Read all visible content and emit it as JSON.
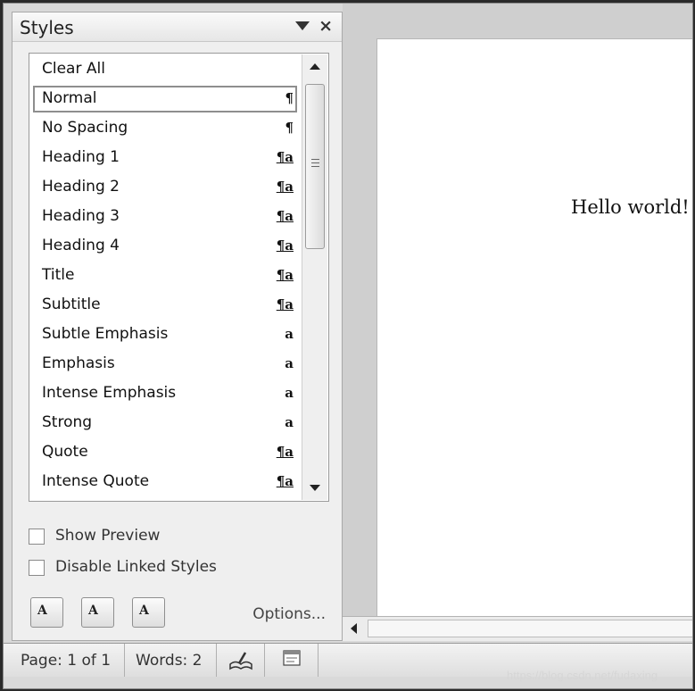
{
  "pane": {
    "title": "Styles",
    "menu_icon": "triangle-down-icon",
    "close_label": "×"
  },
  "styles": [
    {
      "label": "Clear All",
      "glyph": ""
    },
    {
      "label": "Normal",
      "glyph": "¶"
    },
    {
      "label": "No Spacing",
      "glyph": "¶"
    },
    {
      "label": "Heading 1",
      "glyph": "¶a"
    },
    {
      "label": "Heading 2",
      "glyph": "¶a"
    },
    {
      "label": "Heading 3",
      "glyph": "¶a"
    },
    {
      "label": "Heading 4",
      "glyph": "¶a"
    },
    {
      "label": "Title",
      "glyph": "¶a"
    },
    {
      "label": "Subtitle",
      "glyph": "¶a"
    },
    {
      "label": "Subtle Emphasis",
      "glyph": "a"
    },
    {
      "label": "Emphasis",
      "glyph": "a"
    },
    {
      "label": "Intense Emphasis",
      "glyph": "a"
    },
    {
      "label": "Strong",
      "glyph": "a"
    },
    {
      "label": "Quote",
      "glyph": "¶a"
    },
    {
      "label": "Intense Quote",
      "glyph": "¶a"
    }
  ],
  "selected_style": "Normal",
  "options": {
    "show_preview": "Show Preview",
    "disable_linked": "Disable Linked Styles",
    "options_link": "Options..."
  },
  "buttons": {
    "new_style": "A",
    "style_inspector": "A",
    "manage_styles": "A"
  },
  "document": {
    "text": "Hello world!"
  },
  "status": {
    "page": "Page: 1 of 1",
    "words": "Words: 2"
  },
  "watermark": "https://blog.csdn.net/fudaxing"
}
